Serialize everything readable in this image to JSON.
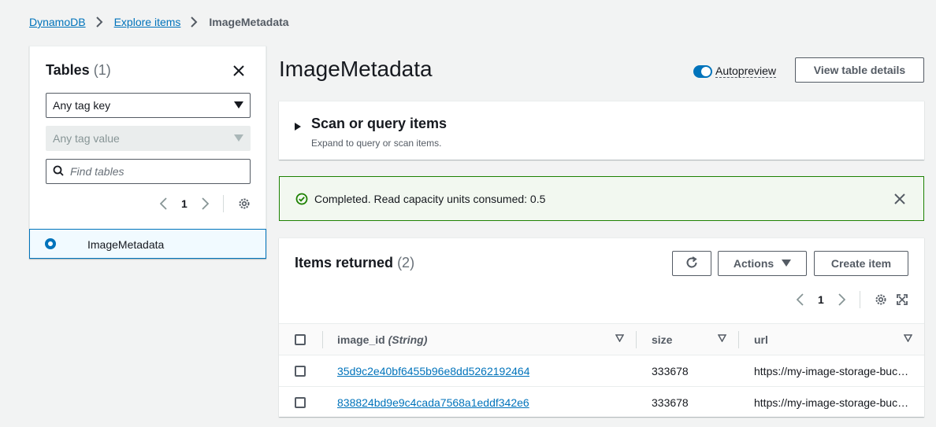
{
  "breadcrumb": {
    "root": "DynamoDB",
    "middle": "Explore items",
    "current": "ImageMetadata"
  },
  "sidebar": {
    "title": "Tables",
    "count": "(1)",
    "tag_key_select": "Any tag key",
    "tag_value_select": "Any tag value",
    "search_placeholder": "Find tables",
    "page_number": "1",
    "tables": [
      {
        "name": "ImageMetadata",
        "selected": true
      }
    ]
  },
  "main": {
    "title": "ImageMetadata",
    "autopreview_label": "Autopreview",
    "autopreview_on": true,
    "view_details_label": "View table details",
    "expander": {
      "title": "Scan or query items",
      "description": "Expand to query or scan items."
    },
    "flash": {
      "message": "Completed. Read capacity units consumed: 0.5",
      "status": "success"
    },
    "items": {
      "title": "Items returned",
      "count": "(2)",
      "actions_label": "Actions",
      "create_label": "Create item",
      "page_number": "1",
      "columns": [
        {
          "name": "image_id",
          "type": "(String)"
        },
        {
          "name": "size"
        },
        {
          "name": "url"
        }
      ],
      "rows": [
        {
          "image_id": "35d9c2e40bf6455b96e8dd5262192464",
          "size": "333678",
          "url": "https://my-image-storage-bucket"
        },
        {
          "image_id": "838824bd9e9c4cada7568a1eddf342e6",
          "size": "333678",
          "url": "https://my-image-storage-bucket"
        }
      ]
    }
  },
  "colors": {
    "link": "#0073bb",
    "success": "#1d8102",
    "text": "#16191f",
    "muted": "#545b64"
  }
}
